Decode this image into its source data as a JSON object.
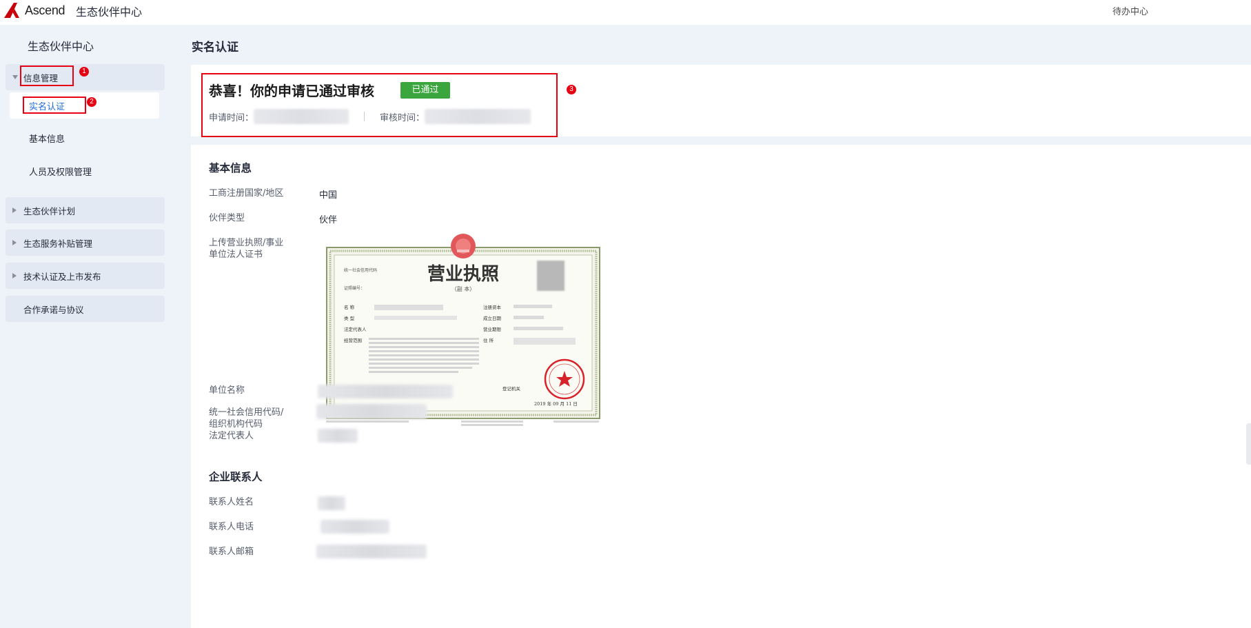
{
  "header": {
    "logo_text": "Ascend",
    "site_title": "生态伙伴中心",
    "todo_link": "待办中心"
  },
  "sidebar": {
    "title": "生态伙伴中心",
    "info_group": {
      "label": "信息管理",
      "items": [
        "实名认证",
        "基本信息",
        "人员及权限管理"
      ]
    },
    "groups": [
      "生态伙伴计划",
      "生态服务补贴管理",
      "技术认证及上市发布"
    ],
    "plain_item": "合作承诺与协议"
  },
  "main": {
    "page_title": "实名认证",
    "status": {
      "heading": "恭喜！你的申请已通过审核",
      "badge": "已通过",
      "apply_time_label": "申请时间：",
      "review_time_label": "审核时间："
    },
    "basic_info": {
      "title": "基本信息",
      "country_label": "工商注册国家/地区",
      "country_value": "中国",
      "type_label": "伙伴类型",
      "type_value": "伙伴",
      "upload_label_1": "上传营业执照/事业",
      "upload_label_2": "单位法人证书",
      "unit_name_label": "单位名称",
      "credit_code_label_1": "统一社会信用代码/",
      "credit_code_label_2": "组织机构代码",
      "legal_rep_label": "法定代表人"
    },
    "contact": {
      "title": "企业联系人",
      "name_label": "联系人姓名",
      "phone_label": "联系人电话",
      "email_label": "联系人邮箱"
    }
  },
  "license": {
    "title": "营业执照",
    "subtitle": "（副 本）",
    "credit_code_label": "统一社会信用代码",
    "cert_no_label": "证照编号：",
    "name_label": "名  称",
    "type_label": "类  型",
    "legal_label": "法定代表人",
    "scope_label": "经营范围",
    "capital_label": "注册资本",
    "date_label": "成立日期",
    "term_label": "营业期限",
    "address_label": "住  所",
    "authority_label": "登记机关",
    "issue_date": "2019 年 09 月 11 日"
  },
  "annotations": [
    "1",
    "2",
    "3"
  ],
  "colors": {
    "accent": "#1f6cd8",
    "badge": "#3ba53e",
    "annotation": "#e60012",
    "page_bg": "#eef2f9"
  }
}
